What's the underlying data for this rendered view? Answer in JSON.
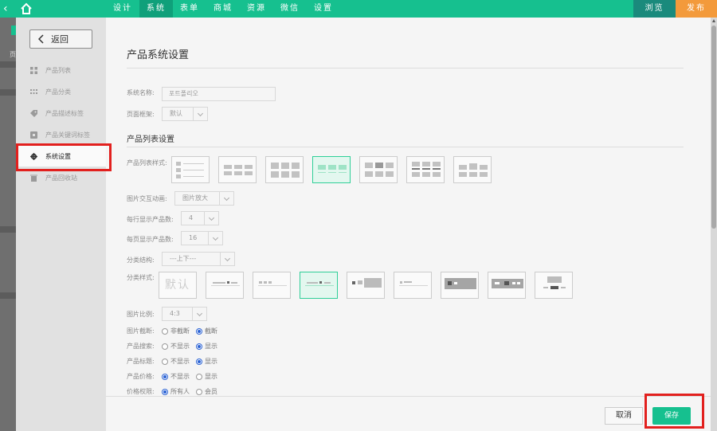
{
  "topbar": {
    "back_glyph": "‹",
    "nav": [
      "设计",
      "系统",
      "表单",
      "商城",
      "资源",
      "微信",
      "设置"
    ],
    "active_nav": "系统",
    "preview_label": "浏览",
    "publish_label": "发布"
  },
  "leftstrip": {
    "label": "页"
  },
  "sidebar": {
    "back_label": "返回",
    "items": [
      {
        "label": "产品列表",
        "icon": "grid-icon"
      },
      {
        "label": "产品分类",
        "icon": "list-icon"
      },
      {
        "label": "产品描述标签",
        "icon": "tag-icon"
      },
      {
        "label": "产品关键词标签",
        "icon": "keyword-tag-icon"
      },
      {
        "label": "系统设置",
        "icon": "gear-icon",
        "active": true
      },
      {
        "label": "产品回收站",
        "icon": "trash-icon"
      }
    ]
  },
  "main": {
    "title": "产品系统设置",
    "system_name_label": "系统名称:",
    "system_name_value": "포트폴리오",
    "page_frame_label": "页面框架:",
    "page_frame_value": "默认",
    "list_section_title": "产品列表设置",
    "list_style_label": "产品列表样式:",
    "list_style_selected": 4,
    "hover_anim_label": "图片交互动画:",
    "hover_anim_value": "图片放大",
    "per_row_label": "每行显示产品数:",
    "per_row_value": "4",
    "per_page_label": "每页显示产品数:",
    "per_page_value": "16",
    "category_struct_label": "分类结构:",
    "category_struct_value": "---上下---",
    "category_style_label": "分类样式:",
    "category_style_default": "默认",
    "category_style_selected": 4,
    "image_ratio_label": "图片比例:",
    "image_ratio_value": "4:3",
    "radios": [
      {
        "label": "图片截断:",
        "options": [
          "非截断",
          "截断"
        ],
        "selected": 1
      },
      {
        "label": "产品搜索:",
        "options": [
          "不显示",
          "显示"
        ],
        "selected": 1
      },
      {
        "label": "产品标题:",
        "options": [
          "不显示",
          "显示"
        ],
        "selected": 1
      },
      {
        "label": "产品价格:",
        "options": [
          "不显示",
          "显示"
        ],
        "selected": 0
      },
      {
        "label": "价格权限:",
        "options": [
          "所有人",
          "会员"
        ],
        "selected": 0
      }
    ]
  },
  "footer": {
    "cancel_label": "取消",
    "save_label": "保存"
  },
  "colors": {
    "brand": "#16c08f",
    "publish": "#f39a3b",
    "highlight": "#e2201e"
  }
}
